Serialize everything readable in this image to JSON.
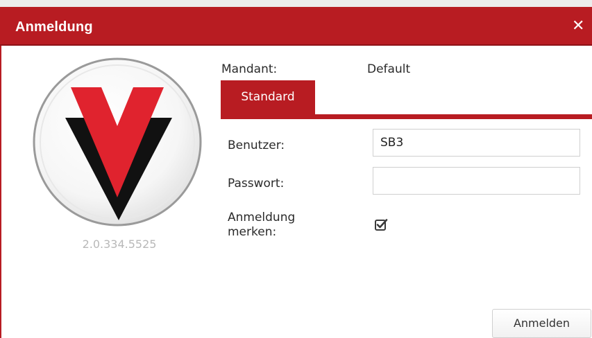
{
  "dialog": {
    "title": "Anmeldung",
    "close_icon": "close-icon",
    "version": "2.0.334.5525",
    "logo_icon": "v-logo-icon"
  },
  "tenant": {
    "label": "Mandant:",
    "value": "Default"
  },
  "tabs": [
    {
      "label": "Standard",
      "active": true
    }
  ],
  "form": {
    "user_label": "Benutzer:",
    "user_value": "SB3",
    "password_label": "Passwort:",
    "password_value": "",
    "remember_label_line1": "Anmeldung",
    "remember_label_line2": "merken:",
    "remember_checked": true,
    "checkbox_icon": "checkbox-checked-icon"
  },
  "buttons": {
    "login_label": "Anmelden"
  },
  "colors": {
    "brand_red": "#b81c22",
    "logo_red": "#e0232e",
    "logo_black": "#111111",
    "version_gray": "#b8b8b8"
  }
}
